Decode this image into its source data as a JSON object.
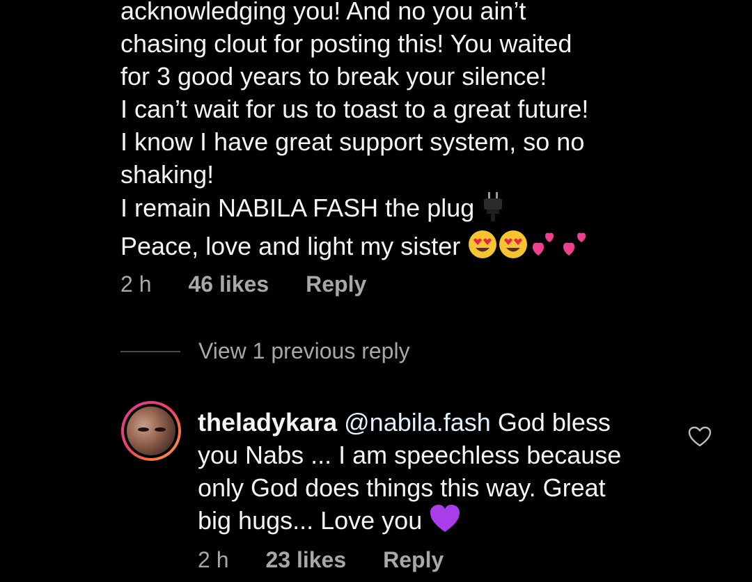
{
  "comment": {
    "lines": [
      "acknowledging you! And no you ain’t",
      "chasing clout for posting this! You waited",
      "for 3 good years to break your silence!",
      "I can’t wait for us to toast to a great future!",
      "I know I have great support system, so no",
      "shaking!",
      "I remain NABILA FASH the plug",
      "Peace, love and light my sister"
    ],
    "time": "2 h",
    "likes": "46 likes",
    "reply_label": "Reply",
    "emojis": [
      "plug-icon",
      "heart-eyes-icon",
      "heart-eyes-icon",
      "two-hearts-icon",
      "two-hearts-icon"
    ]
  },
  "thread": {
    "view_previous": "View 1 previous reply"
  },
  "reply": {
    "username": "theladykara",
    "mention": "@nabila.fash",
    "text_first": " God bless",
    "lines": [
      "you Nabs ... I am speechless because",
      "only God does things this way. Great",
      "big hugs... Love you"
    ],
    "time": "2 h",
    "likes": "23 likes",
    "reply_label": "Reply",
    "emojis": [
      "purple-heart-icon"
    ]
  },
  "colors": {
    "background": "#000000",
    "text": "#f5f5f5",
    "meta": "#a8a8a8",
    "avatar_ring": [
      "#d93aa6",
      "#f0465b",
      "#f7a13a"
    ]
  }
}
